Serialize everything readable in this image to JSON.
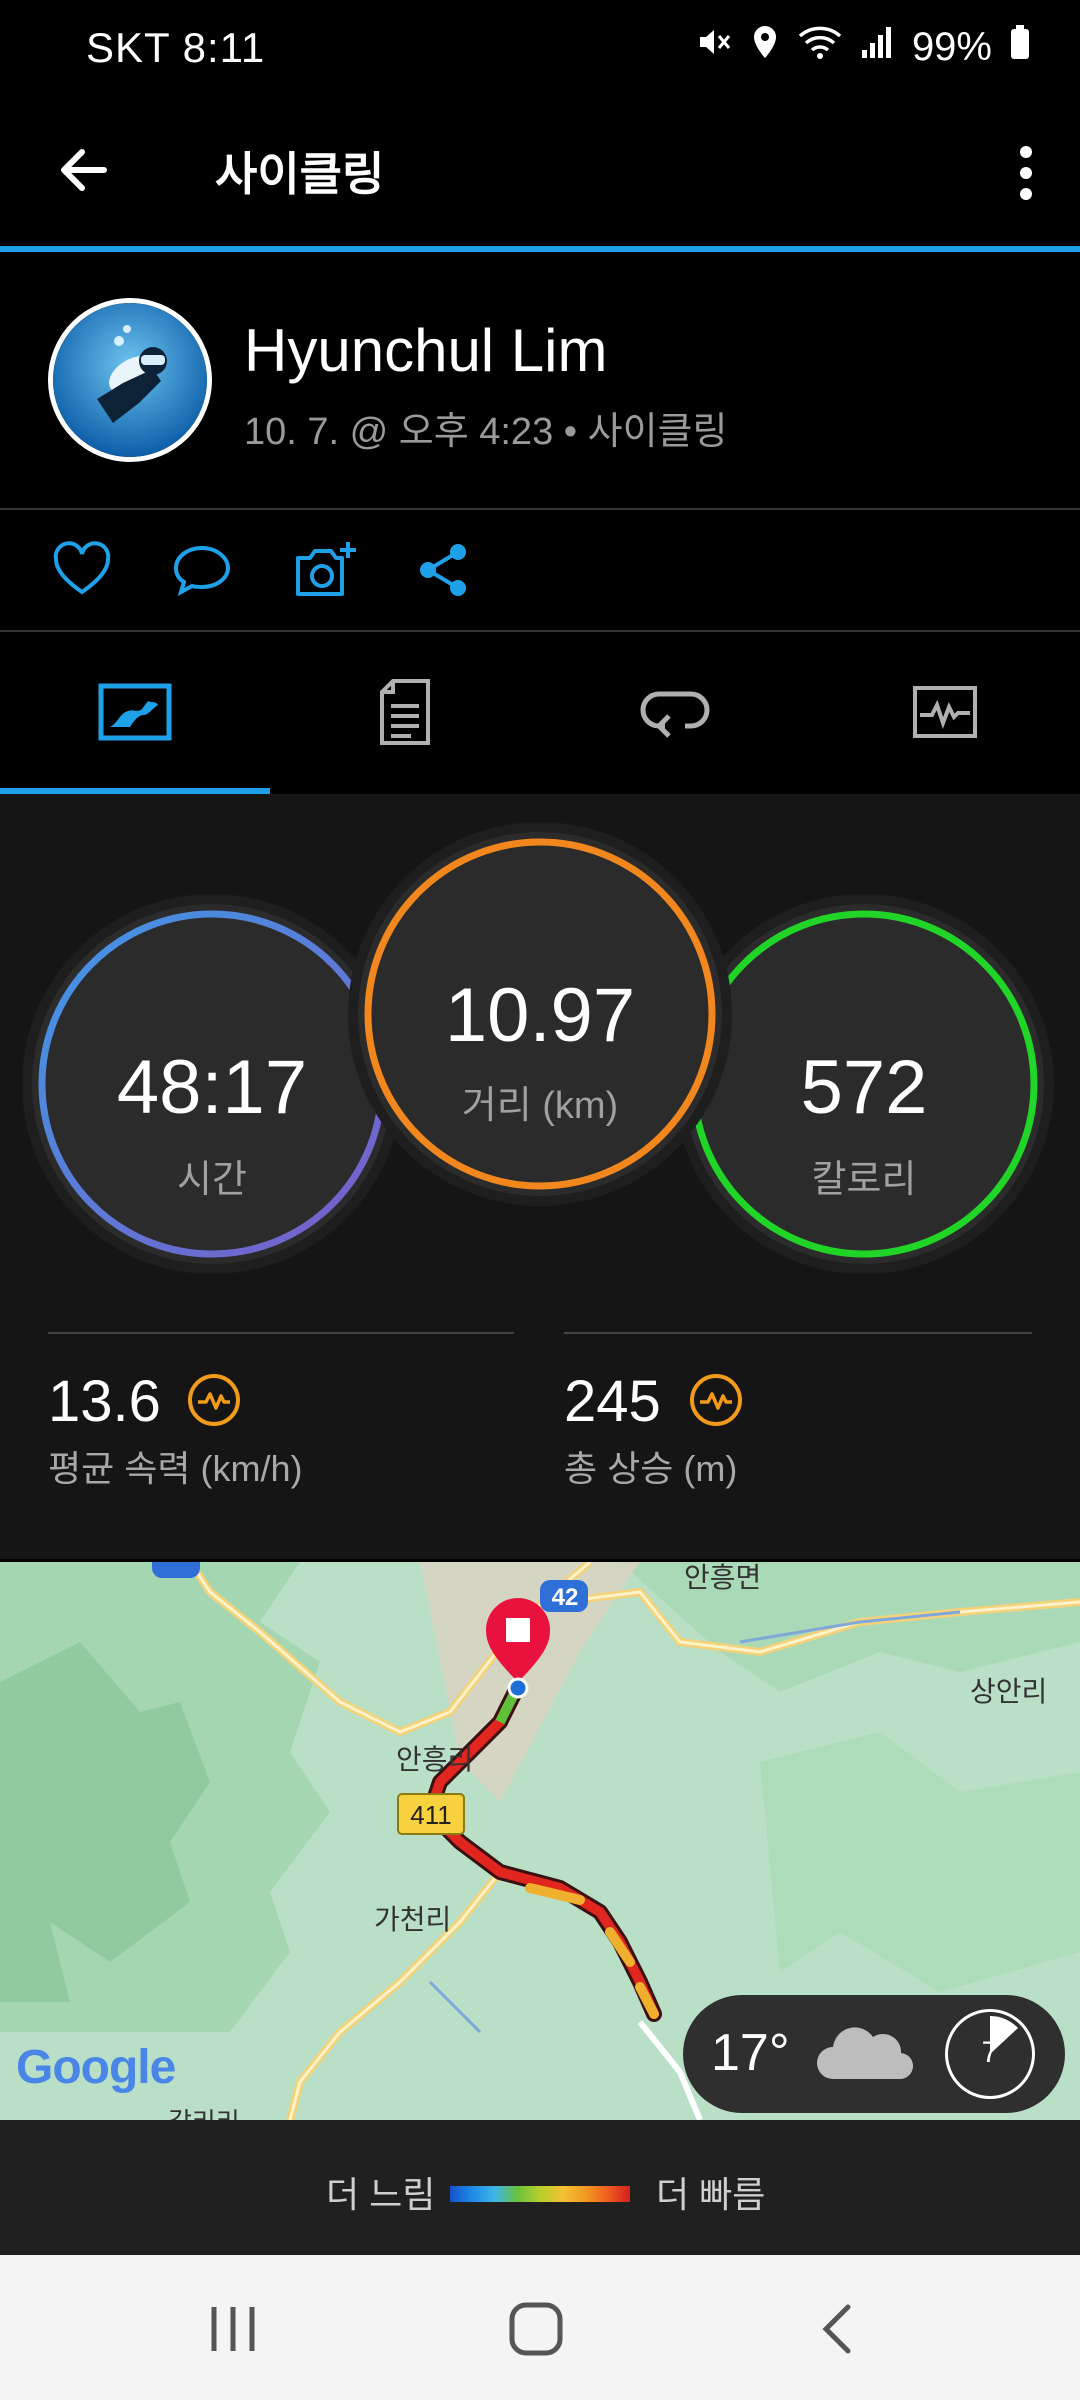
{
  "status_bar": {
    "carrier_time": "SKT  8:11",
    "battery": "99%"
  },
  "header": {
    "title": "사이클링"
  },
  "profile": {
    "name": "Hyunchul Lim",
    "meta": "10. 7. @ 오후 4:23 • 사이클링"
  },
  "summary": {
    "time": {
      "value": "48:17",
      "label": "시간"
    },
    "distance": {
      "value": "10.97",
      "label": "거리 (km)"
    },
    "calories": {
      "value": "572",
      "label": "칼로리"
    },
    "avg_speed": {
      "value": "13.6",
      "label": "평균 속력 (km/h)"
    },
    "total_ascent": {
      "value": "245",
      "label": "총 상승 (m)"
    }
  },
  "map": {
    "labels": {
      "anheung_myeon": "안흥면",
      "sangan_ri": "상안리",
      "anheung_ri": "안흥리",
      "gacheon_ri": "가천리",
      "gari_ri": "갈리리"
    },
    "road_42": "42",
    "road_411": "411",
    "google": "Google",
    "weather": {
      "temp": "17°",
      "wind": "7"
    }
  },
  "legend": {
    "slow": "더 느림",
    "fast": "더 빠름"
  },
  "colors": {
    "accent": "#1ea1e8",
    "time_ring": "#3f8fdc",
    "distance_ring": "#f2871e",
    "calorie_ring": "#21d428"
  }
}
